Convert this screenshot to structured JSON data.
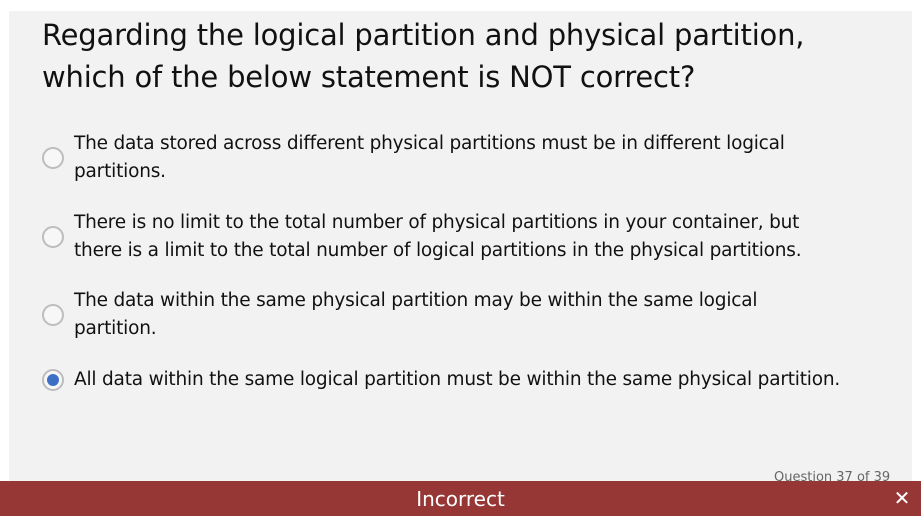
{
  "question": {
    "text": "Regarding the logical partition and physical partition, which of the below statement is NOT correct?",
    "options": [
      {
        "label": "The data stored across different physical partitions must be in different logical partitions.",
        "selected": false
      },
      {
        "label": "There is no limit to the total number of physical partitions in your container, but there is a limit to the total number of logical partitions in the physical partitions.",
        "selected": false
      },
      {
        "label": "The data within the same physical partition may be within the same logical partition.",
        "selected": false
      },
      {
        "label": "All data within the same logical partition must be within the same physical partition.",
        "selected": true
      }
    ],
    "counter": "Question 37 of 39"
  },
  "feedback": {
    "status": "Incorrect",
    "close_icon": "close-icon",
    "color": "#963735"
  },
  "accent": "#3d6fc4"
}
